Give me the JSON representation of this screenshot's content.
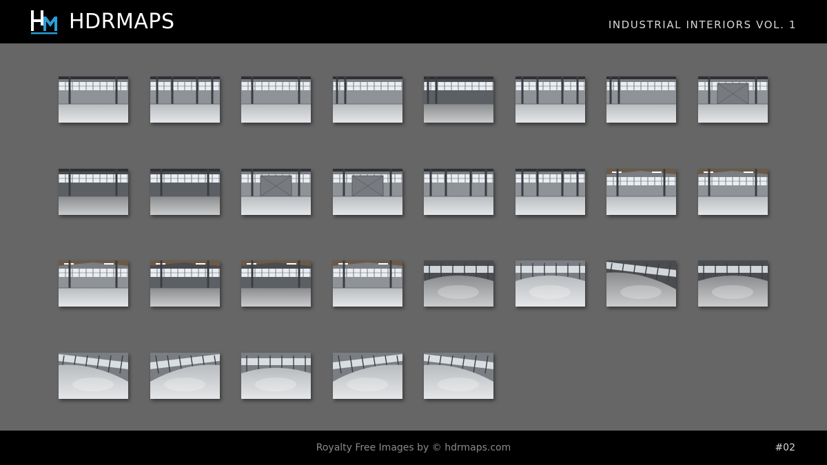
{
  "header": {
    "brand": "HDRMAPS",
    "logo_icon": "hm-monogram-icon",
    "collection_title": "INDUSTRIAL INTERIORS VOL. 1"
  },
  "colors": {
    "background": "#666666",
    "bars": "#000000",
    "logo_accent": "#2a9fd8"
  },
  "gallery": {
    "rows": [
      [
        {
          "view": "hall-straight",
          "tone": "light"
        },
        {
          "view": "hall-columns",
          "tone": "light"
        },
        {
          "view": "hall-straight",
          "tone": "light"
        },
        {
          "view": "hall-corner",
          "tone": "light"
        },
        {
          "view": "hall-corner",
          "tone": "dark"
        },
        {
          "view": "hall-columns",
          "tone": "light"
        },
        {
          "view": "hall-corner",
          "tone": "light"
        },
        {
          "view": "wall-door",
          "tone": "light"
        }
      ],
      [
        {
          "view": "hall-straight",
          "tone": "dark"
        },
        {
          "view": "hall-straight",
          "tone": "dark"
        },
        {
          "view": "wall-door",
          "tone": "light"
        },
        {
          "view": "wall-door",
          "tone": "light"
        },
        {
          "view": "hall-columns",
          "tone": "light"
        },
        {
          "view": "hall-columns",
          "tone": "light"
        },
        {
          "view": "hall-roof",
          "tone": "light"
        },
        {
          "view": "hall-roof",
          "tone": "light"
        }
      ],
      [
        {
          "view": "hall-roof",
          "tone": "light"
        },
        {
          "view": "hall-roof",
          "tone": "dark"
        },
        {
          "view": "hall-roof",
          "tone": "dark"
        },
        {
          "view": "hall-roof",
          "tone": "light"
        },
        {
          "view": "floor-wide",
          "tone": "dark"
        },
        {
          "view": "floor-wide",
          "tone": "light"
        },
        {
          "view": "floor-tilted",
          "tone": "dark"
        },
        {
          "view": "floor-wide",
          "tone": "dark"
        }
      ],
      [
        {
          "view": "floor-tilted",
          "tone": "light"
        },
        {
          "view": "floor-tilted",
          "tone": "light"
        },
        {
          "view": "floor-wide",
          "tone": "light"
        },
        {
          "view": "floor-tilted",
          "tone": "light"
        },
        {
          "view": "floor-tilted",
          "tone": "light"
        }
      ]
    ]
  },
  "footer": {
    "credit": "Royalty Free Images by © hdrmaps.com",
    "page_number": "#02"
  }
}
